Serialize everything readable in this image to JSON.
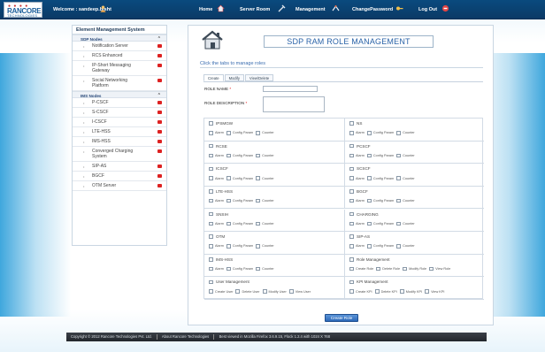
{
  "header": {
    "logo": {
      "name": "RANCORE",
      "tagline": "TECHNOLOGIES"
    },
    "welcome": "Welcome : sandeep.bisht",
    "nav": [
      {
        "label": "Home",
        "icon": "home-icon"
      },
      {
        "label": "Server Room",
        "icon": "tools-icon"
      },
      {
        "label": "Management",
        "icon": "management-icon"
      },
      {
        "label": "ChangePassword",
        "icon": "key-icon"
      },
      {
        "label": "Log Out",
        "icon": "logout-icon"
      }
    ]
  },
  "sidebar": {
    "title": "Element Management System",
    "sections": [
      {
        "label": "SDP Nodes",
        "items": [
          "Notification Server",
          "RCS Enhanced",
          "IP-Short Messaging Gateway",
          "Social Networking Platform"
        ]
      },
      {
        "label": "IMS Nodes",
        "items": [
          "P-CSCF",
          "S-CSCF",
          "I-CSCF",
          "LTE-HSS",
          "IMS-HSS",
          "Converged Charging System",
          "SIP-AS",
          "BGCF",
          "OTM Server"
        ]
      }
    ]
  },
  "main": {
    "title": "SDP RAM ROLE MANAGEMENT",
    "instruction": "Click the tabs to manage roles",
    "tabs": [
      "Create",
      "Modify",
      "View/Delete"
    ],
    "role_name_label": "ROLE NAME",
    "role_desc_label": "ROLE DESCRIPTION",
    "required_mark": "*",
    "permissions": [
      {
        "name": "IPSMGW",
        "options": [
          "Alarm",
          "Config Param",
          "Counter"
        ]
      },
      {
        "name": "NS",
        "options": [
          "Alarm",
          "Config Param",
          "Counter"
        ]
      },
      {
        "name": "RCSE",
        "options": [
          "Alarm",
          "Config Param",
          "Counter"
        ]
      },
      {
        "name": "PCSCF",
        "options": [
          "Alarm",
          "Config Param",
          "Counter"
        ]
      },
      {
        "name": "ICSCF",
        "options": [
          "Alarm",
          "Config Param",
          "Counter"
        ]
      },
      {
        "name": "SCSCF",
        "options": [
          "Alarm",
          "Config Param",
          "Counter"
        ]
      },
      {
        "name": "LTE-HSS",
        "options": [
          "Alarm",
          "Config Param",
          "Counter"
        ]
      },
      {
        "name": "BGCF",
        "options": [
          "Alarm",
          "Config Param",
          "Counter"
        ]
      },
      {
        "name": "SNSIH",
        "options": [
          "Alarm",
          "Config Param",
          "Counter"
        ]
      },
      {
        "name": "CHARGING",
        "options": [
          "Alarm",
          "Config Param",
          "Counter"
        ]
      },
      {
        "name": "OTM",
        "options": [
          "Alarm",
          "Config Param",
          "Counter"
        ]
      },
      {
        "name": "SIP-AS",
        "options": [
          "Alarm",
          "Config Param",
          "Counter"
        ]
      },
      {
        "name": "IMS-HSS",
        "options": [
          "Alarm",
          "Config Param",
          "Counter"
        ]
      },
      {
        "name": "Role Management",
        "options": [
          "Create Role",
          "Delete Role",
          "Modify Role",
          "View Role"
        ]
      },
      {
        "name": "User Management",
        "options": [
          "Create User",
          "Delete User",
          "Modify User",
          "View User"
        ]
      },
      {
        "name": "KPI Management",
        "options": [
          "Create KPI",
          "Delete KPI",
          "Modify KPI",
          "View KPI"
        ]
      }
    ],
    "create_button": "Create Role"
  },
  "footer": {
    "copyright": "Copyright © 2012 Rancore Technologies Pvt. Ltd.",
    "about": "About Rancore Technologies",
    "best_viewed": "Best viewed in Mozilla Firefox 3.6.9.15, Flock 1.2.4 with 1024 X 768"
  },
  "colors": {
    "header_bg": "#0b3a66",
    "accent": "#2a63a8",
    "delete_red": "#dd2222"
  }
}
